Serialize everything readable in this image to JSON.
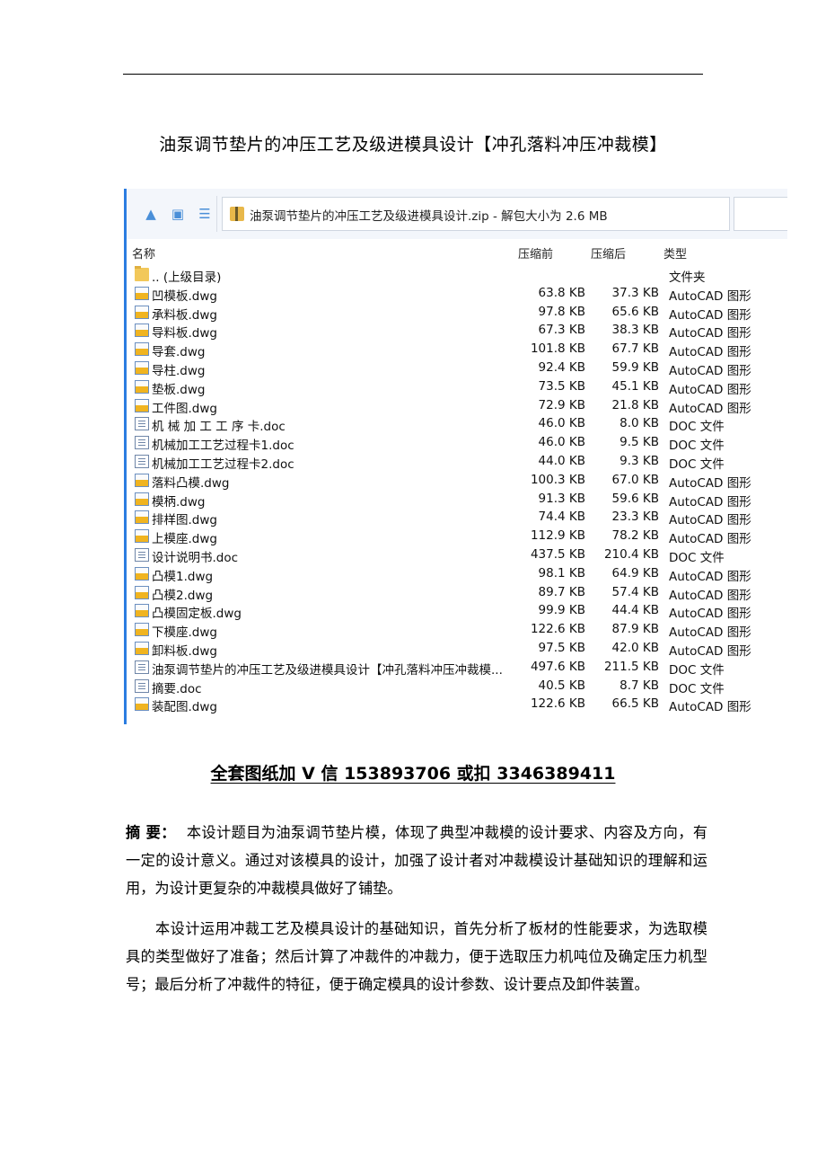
{
  "document": {
    "title": "油泵调节垫片的冲压工艺及级进模具设计【冲孔落料冲压冲裁模】",
    "contact": "全套图纸加 V 信 153893706 或扣  3346389411",
    "abstract_label": "摘    要：",
    "abstract_p1": "本设计题目为油泵调节垫片模，体现了典型冲裁模的设计要求、内容及方向，有一定的设计意义。通过对该模具的设计，加强了设计者对冲裁模设计基础知识的理解和运用，为设计更复杂的冲裁模具做好了铺垫。",
    "abstract_p2": "本设计运用冲裁工艺及模具设计的基础知识，首先分析了板材的性能要求，为选取模具的类型做好了准备；然后计算了冲裁件的冲裁力，便于选取压力机吨位及确定压力机型号；最后分析了冲裁件的特征，便于确定模具的设计参数、设计要点及卸件装置。"
  },
  "archive": {
    "path": "油泵调节垫片的冲压工艺及级进模具设计.zip - 解包大小为 2.6 MB",
    "columns": {
      "name": "名称",
      "packed": "压缩前",
      "compressed": "压缩后",
      "type": "类型"
    },
    "files": [
      {
        "name": ".. (上级目录)",
        "size": "",
        "packed": "",
        "type": "文件夹",
        "icon": "folder-icon"
      },
      {
        "name": "凹模板.dwg",
        "size": "63.8 KB",
        "packed": "37.3 KB",
        "type": "AutoCAD 图形",
        "icon": "dwg-file-icon"
      },
      {
        "name": "承料板.dwg",
        "size": "97.8 KB",
        "packed": "65.6 KB",
        "type": "AutoCAD 图形",
        "icon": "dwg-file-icon"
      },
      {
        "name": "导料板.dwg",
        "size": "67.3 KB",
        "packed": "38.3 KB",
        "type": "AutoCAD 图形",
        "icon": "dwg-file-icon"
      },
      {
        "name": "导套.dwg",
        "size": "101.8 KB",
        "packed": "67.7 KB",
        "type": "AutoCAD 图形",
        "icon": "dwg-file-icon"
      },
      {
        "name": "导柱.dwg",
        "size": "92.4 KB",
        "packed": "59.9 KB",
        "type": "AutoCAD 图形",
        "icon": "dwg-file-icon"
      },
      {
        "name": "垫板.dwg",
        "size": "73.5 KB",
        "packed": "45.1 KB",
        "type": "AutoCAD 图形",
        "icon": "dwg-file-icon"
      },
      {
        "name": "工件图.dwg",
        "size": "72.9 KB",
        "packed": "21.8 KB",
        "type": "AutoCAD 图形",
        "icon": "dwg-file-icon"
      },
      {
        "name": "机 械 加 工 工 序 卡.doc",
        "size": "46.0 KB",
        "packed": "8.0 KB",
        "type": "DOC 文件",
        "icon": "doc-file-icon"
      },
      {
        "name": "机械加工工艺过程卡1.doc",
        "size": "46.0 KB",
        "packed": "9.5 KB",
        "type": "DOC 文件",
        "icon": "doc-file-icon"
      },
      {
        "name": "机械加工工艺过程卡2.doc",
        "size": "44.0 KB",
        "packed": "9.3 KB",
        "type": "DOC 文件",
        "icon": "doc-file-icon"
      },
      {
        "name": "落料凸模.dwg",
        "size": "100.3 KB",
        "packed": "67.0 KB",
        "type": "AutoCAD 图形",
        "icon": "dwg-file-icon"
      },
      {
        "name": "模柄.dwg",
        "size": "91.3 KB",
        "packed": "59.6 KB",
        "type": "AutoCAD 图形",
        "icon": "dwg-file-icon"
      },
      {
        "name": "排样图.dwg",
        "size": "74.4 KB",
        "packed": "23.3 KB",
        "type": "AutoCAD 图形",
        "icon": "dwg-file-icon"
      },
      {
        "name": "上模座.dwg",
        "size": "112.9 KB",
        "packed": "78.2 KB",
        "type": "AutoCAD 图形",
        "icon": "dwg-file-icon"
      },
      {
        "name": "设计说明书.doc",
        "size": "437.5 KB",
        "packed": "210.4 KB",
        "type": "DOC 文件",
        "icon": "doc-file-icon"
      },
      {
        "name": "凸模1.dwg",
        "size": "98.1 KB",
        "packed": "64.9 KB",
        "type": "AutoCAD 图形",
        "icon": "dwg-file-icon"
      },
      {
        "name": "凸模2.dwg",
        "size": "89.7 KB",
        "packed": "57.4 KB",
        "type": "AutoCAD 图形",
        "icon": "dwg-file-icon"
      },
      {
        "name": "凸模固定板.dwg",
        "size": "99.9 KB",
        "packed": "44.4 KB",
        "type": "AutoCAD 图形",
        "icon": "dwg-file-icon"
      },
      {
        "name": "下模座.dwg",
        "size": "122.6 KB",
        "packed": "87.9 KB",
        "type": "AutoCAD 图形",
        "icon": "dwg-file-icon"
      },
      {
        "name": "卸料板.dwg",
        "size": "97.5 KB",
        "packed": "42.0 KB",
        "type": "AutoCAD 图形",
        "icon": "dwg-file-icon"
      },
      {
        "name": "油泵调节垫片的冲压工艺及级进模具设计【冲孔落料冲压冲裁模...",
        "size": "497.6 KB",
        "packed": "211.5 KB",
        "type": "DOC 文件",
        "icon": "doc-file-icon"
      },
      {
        "name": "摘要.doc",
        "size": "40.5 KB",
        "packed": "8.7 KB",
        "type": "DOC 文件",
        "icon": "doc-file-icon"
      },
      {
        "name": "装配图.dwg",
        "size": "122.6 KB",
        "packed": "66.5 KB",
        "type": "AutoCAD 图形",
        "icon": "dwg-file-icon"
      }
    ]
  },
  "colors": {
    "accent": "#2b7de1",
    "v_logo": "#f0a818"
  }
}
